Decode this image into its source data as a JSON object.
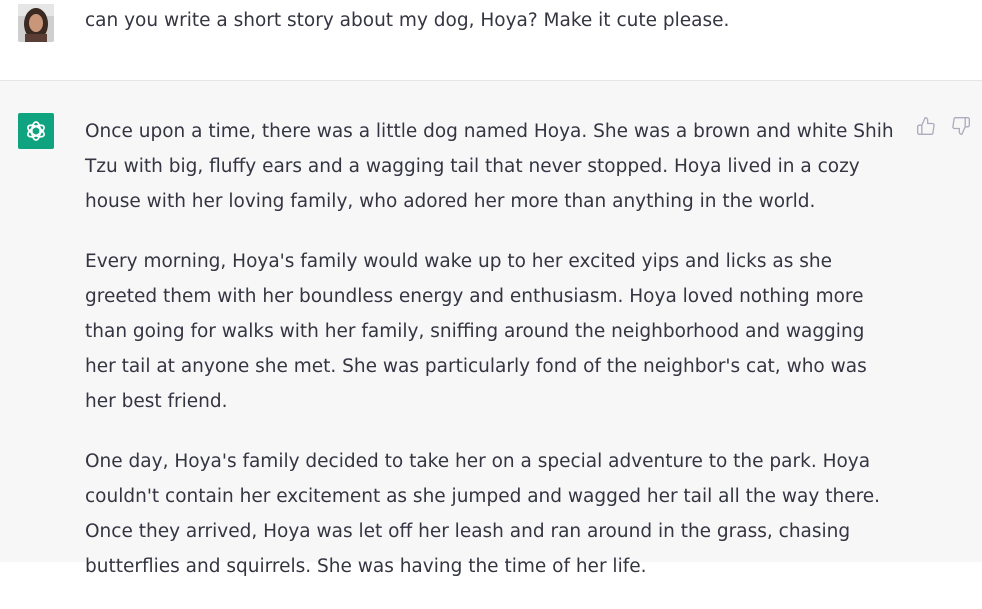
{
  "user_message": {
    "text": "can you write a short story about my dog, Hoya? Make it cute please."
  },
  "assistant_message": {
    "paragraphs": [
      "Once upon a time, there was a little dog named Hoya. She was a brown and white Shih Tzu with big, fluffy ears and a wagging tail that never stopped. Hoya lived in a cozy house with her loving family, who adored her more than anything in the world.",
      "Every morning, Hoya's family would wake up to her excited yips and licks as she greeted them with her boundless energy and enthusiasm. Hoya loved nothing more than going for walks with her family, sniffing around the neighborhood and wagging her tail at anyone she met. She was particularly fond of the neighbor's cat, who was her best friend.",
      "One day, Hoya's family decided to take her on a special adventure to the park. Hoya couldn't contain her excitement as she jumped and wagged her tail all the way there. Once they arrived, Hoya was let off her leash and ran around in the grass, chasing butterflies and squirrels. She was having the time of her life."
    ]
  },
  "icons": {
    "user_avatar": "user-avatar-photo",
    "assistant_avatar": "openai-logo-icon",
    "feedback_up": "thumbs-up-icon",
    "feedback_down": "thumbs-down-icon"
  },
  "colors": {
    "assistant_background": "#f7f7f8",
    "assistant_avatar_bg": "#10a37f",
    "text": "#343541",
    "icon": "#acacbe"
  }
}
